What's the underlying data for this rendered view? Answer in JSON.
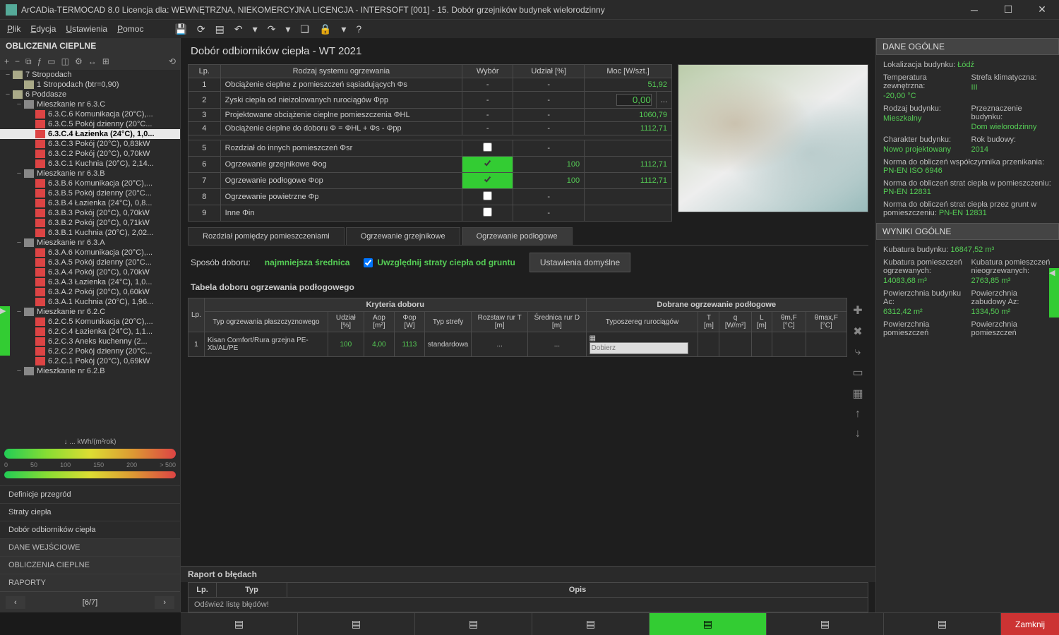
{
  "titlebar": {
    "title": "ArCADia-TERMOCAD 8.0 Licencja dla: WEWNĘTRZNA, NIEKOMERCYJNA LICENCJA - INTERSOFT [001] - 15. Dobór grzejników budynek wielorodzinny"
  },
  "menu": {
    "items": [
      "Plik",
      "Edycja",
      "Ustawienia",
      "Pomoc"
    ]
  },
  "left": {
    "title": "OBLICZENIA CIEPLNE",
    "tree": [
      {
        "depth": 0,
        "toggle": "−",
        "icon": "building",
        "label": "7 Stropodach"
      },
      {
        "depth": 1,
        "toggle": "",
        "icon": "building",
        "label": "1 Stropodach (btr=0,90)"
      },
      {
        "depth": 0,
        "toggle": "−",
        "icon": "building",
        "label": "6 Poddasze"
      },
      {
        "depth": 1,
        "toggle": "−",
        "icon": "folder",
        "label": "Mieszkanie nr 6.3.C"
      },
      {
        "depth": 2,
        "toggle": "",
        "icon": "room",
        "label": "6.3.C.6 Komunikacja (20°C),..."
      },
      {
        "depth": 2,
        "toggle": "",
        "icon": "room",
        "label": "6.3.C.5 Pokój dzienny (20°C..."
      },
      {
        "depth": 2,
        "toggle": "",
        "icon": "room",
        "label": "6.3.C.4 Łazienka (24°C), 1,0...",
        "selected": true
      },
      {
        "depth": 2,
        "toggle": "",
        "icon": "room",
        "label": "6.3.C.3 Pokój (20°C), 0,83kW"
      },
      {
        "depth": 2,
        "toggle": "",
        "icon": "room",
        "label": "6.3.C.2 Pokój (20°C), 0,70kW"
      },
      {
        "depth": 2,
        "toggle": "",
        "icon": "room",
        "label": "6.3.C.1 Kuchnia (20°C), 2,14..."
      },
      {
        "depth": 1,
        "toggle": "−",
        "icon": "folder",
        "label": "Mieszkanie nr 6.3.B"
      },
      {
        "depth": 2,
        "toggle": "",
        "icon": "room",
        "label": "6.3.B.6 Komunikacja (20°C),..."
      },
      {
        "depth": 2,
        "toggle": "",
        "icon": "room",
        "label": "6.3.B.5 Pokój dzienny (20°C..."
      },
      {
        "depth": 2,
        "toggle": "",
        "icon": "room",
        "label": "6.3.B.4 Łazienka (24°C), 0,8..."
      },
      {
        "depth": 2,
        "toggle": "",
        "icon": "room",
        "label": "6.3.B.3 Pokój (20°C), 0,70kW"
      },
      {
        "depth": 2,
        "toggle": "",
        "icon": "room",
        "label": "6.3.B.2 Pokój (20°C), 0,71kW"
      },
      {
        "depth": 2,
        "toggle": "",
        "icon": "room",
        "label": "6.3.B.1 Kuchnia (20°C), 2,02..."
      },
      {
        "depth": 1,
        "toggle": "−",
        "icon": "folder",
        "label": "Mieszkanie nr 6.3.A"
      },
      {
        "depth": 2,
        "toggle": "",
        "icon": "room",
        "label": "6.3.A.6 Komunikacja (20°C),..."
      },
      {
        "depth": 2,
        "toggle": "",
        "icon": "room",
        "label": "6.3.A.5 Pokój dzienny (20°C..."
      },
      {
        "depth": 2,
        "toggle": "",
        "icon": "room",
        "label": "6.3.A.4 Pokój (20°C), 0,70kW"
      },
      {
        "depth": 2,
        "toggle": "",
        "icon": "room",
        "label": "6.3.A.3 Łazienka (24°C), 1,0..."
      },
      {
        "depth": 2,
        "toggle": "",
        "icon": "room",
        "label": "6.3.A.2 Pokój (20°C), 0,60kW"
      },
      {
        "depth": 2,
        "toggle": "",
        "icon": "room",
        "label": "6.3.A.1 Kuchnia (20°C), 1,96..."
      },
      {
        "depth": 1,
        "toggle": "−",
        "icon": "folder",
        "label": "Mieszkanie nr 6.2.C"
      },
      {
        "depth": 2,
        "toggle": "",
        "icon": "room",
        "label": "6.2.C.5 Komunikacja (20°C),..."
      },
      {
        "depth": 2,
        "toggle": "",
        "icon": "room",
        "label": "6.2.C.4 Łazienka (24°C), 1,1..."
      },
      {
        "depth": 2,
        "toggle": "",
        "icon": "room",
        "label": "6.2.C.3 Aneks kuchenny (2..."
      },
      {
        "depth": 2,
        "toggle": "",
        "icon": "room",
        "label": "6.2.C.2 Pokój dzienny (20°C..."
      },
      {
        "depth": 2,
        "toggle": "",
        "icon": "room",
        "label": "6.2.C.1 Pokój (20°C), 0,69kW"
      },
      {
        "depth": 1,
        "toggle": "−",
        "icon": "folder",
        "label": "Mieszkanie nr 6.2.B"
      }
    ],
    "scale_unit": "kWh/(m²rok)",
    "scale_ticks": [
      "0",
      "50",
      "100",
      "150",
      "200",
      "> 500"
    ],
    "nav": {
      "items": [
        "Definicje przegród",
        "Straty ciepła",
        "Dobór odbiorników ciepła"
      ],
      "headers": [
        "DANE WEJŚCIOWE",
        "OBLICZENIA CIEPLNE",
        "RAPORTY"
      ]
    },
    "pager": {
      "prev": "‹",
      "label": "[6/7]",
      "next": "›"
    }
  },
  "center": {
    "breadcrumb": "Dobór odbiorników ciepła - WT 2021",
    "sys_headers": {
      "lp": "Lp.",
      "type": "Rodzaj systemu ogrzewania",
      "wybor": "Wybór",
      "udzial": "Udział [%]",
      "moc": "Moc [W/szt.]"
    },
    "sys_rows": [
      {
        "lp": "1",
        "type": "Obciążenie cieplne z pomieszczeń sąsiadujących Φs",
        "wybor": "-",
        "udzial": "-",
        "moc": "51,92"
      },
      {
        "lp": "2",
        "type": "Zyski ciepła od nieizolowanych rurociągów Φpp",
        "wybor": "-",
        "udzial": "-",
        "moc_input": "0,00"
      },
      {
        "lp": "3",
        "type": "Projektowane obciążenie cieplne pomieszczenia ΦHL",
        "wybor": "-",
        "udzial": "-",
        "moc": "1060,79"
      },
      {
        "lp": "4",
        "type": "Obciążenie cieplne do doboru Φ = ΦHL + Φs - Φpp",
        "wybor": "-",
        "udzial": "-",
        "moc": "1112,71"
      },
      {
        "sep": true
      },
      {
        "lp": "5",
        "type": "Rozdział do innych pomieszczeń Φsr",
        "check": false,
        "udzial": "-",
        "moc": ""
      },
      {
        "lp": "6",
        "type": "Ogrzewanie grzejnikowe Φog",
        "check": true,
        "udzial": "100",
        "moc": "1112,71"
      },
      {
        "lp": "7",
        "type": "Ogrzewanie podłogowe Φop",
        "check": true,
        "udzial": "100",
        "moc": "1112,71"
      },
      {
        "lp": "8",
        "type": "Ogrzewanie powietrzne Φp",
        "check": false,
        "udzial": "-",
        "moc": ""
      },
      {
        "lp": "9",
        "type": "Inne Φin",
        "check": false,
        "udzial": "-",
        "moc": ""
      }
    ],
    "tabs": [
      "Rozdział pomiędzy pomieszczeniami",
      "Ogrzewanie grzejnikowe",
      "Ogrzewanie podłogowe"
    ],
    "active_tab": 2,
    "options": {
      "sposob_label": "Sposób doboru:",
      "sposob_value": "najmniejsza średnica",
      "check_label": "Uwzględnij straty ciepła od gruntu",
      "button": "Ustawienia domyślne"
    },
    "sub_title": "Tabela doboru ogrzewania podłogowego",
    "sel_group1": "Kryteria doboru",
    "sel_group2": "Dobrane ogrzewanie podłogowe",
    "sel_headers": {
      "lp": "Lp.",
      "typ": "Typ ogrzewania płaszczyznowego",
      "udzial": "Udział [%]",
      "aop": "Aop [m²]",
      "fop": "Φop [W]",
      "strefa": "Typ strefy",
      "rozstaw": "Rozstaw rur T [m]",
      "srednica": "Średnica rur D [m]",
      "typoszereg": "Typoszereg rurociągów",
      "t": "T [m]",
      "q": "q [W/m²]",
      "l": "L [m]",
      "thm": "θm,F [°C]",
      "thmax": "θmax,F [°C]"
    },
    "sel_row": {
      "lp": "1",
      "typ": "Kisan Comfort/Rura grzejna PE-Xb/AL/PE",
      "udzial": "100",
      "aop": "4,00",
      "fop": "1113",
      "strefa": "standardowa",
      "dobierz": "Dobierz"
    },
    "error": {
      "title": "Raport o błędach",
      "lp": "Lp.",
      "typ": "Typ",
      "opis": "Opis",
      "msg": "Odśwież listę błędów!"
    }
  },
  "right": {
    "h1": "DANE OGÓLNE",
    "loc_label": "Lokalizacja budynku:",
    "loc_val": "Łódź",
    "temp_label": "Temperatura zewnętrzna:",
    "temp_val": "-20,00 °C",
    "strefa_label": "Strefa klimatyczna:",
    "strefa_val": "III",
    "rodzaj_label": "Rodzaj budynku:",
    "rodzaj_val": "Mieszkalny",
    "przez_label": "Przeznaczenie budynku:",
    "przez_val": "Dom wielorodzinny",
    "char_label": "Charakter budynku:",
    "char_val": "Nowo projektowany",
    "rok_label": "Rok budowy:",
    "rok_val": "2014",
    "norma1_label": "Norma do obliczeń współczynnika przenikania:",
    "norma1_val": "PN-EN ISO 6946",
    "norma2_label": "Norma do obliczeń strat ciepła w pomieszczeniu:",
    "norma2_val": "PN-EN 12831",
    "norma3_label": "Norma do obliczeń strat ciepła przez grunt w pomieszczeniu:",
    "norma3_val": "PN-EN 12831",
    "h2": "WYNIKI OGÓLNE",
    "kub_label": "Kubatura budynku:",
    "kub_val": "16847,52 m³",
    "kub_ogr_label": "Kubatura pomieszczeń ogrzewanych:",
    "kub_ogr_val": "14083,68 m³",
    "kub_nie_label": "Kubatura pomieszczeń nieogrzewanych:",
    "kub_nie_val": "2763,85 m³",
    "pow_ac_label": "Powierzchnia budynku Ac:",
    "pow_ac_val": "6312,42 m²",
    "pow_az_label": "Powierzchnia zabudowy Az:",
    "pow_az_val": "1334,50 m²",
    "pow_pom1": "Powierzchnia pomieszczeń",
    "pow_pom2": "Powierzchnia pomieszczeń"
  },
  "bottom": {
    "close": "Zamknij"
  }
}
